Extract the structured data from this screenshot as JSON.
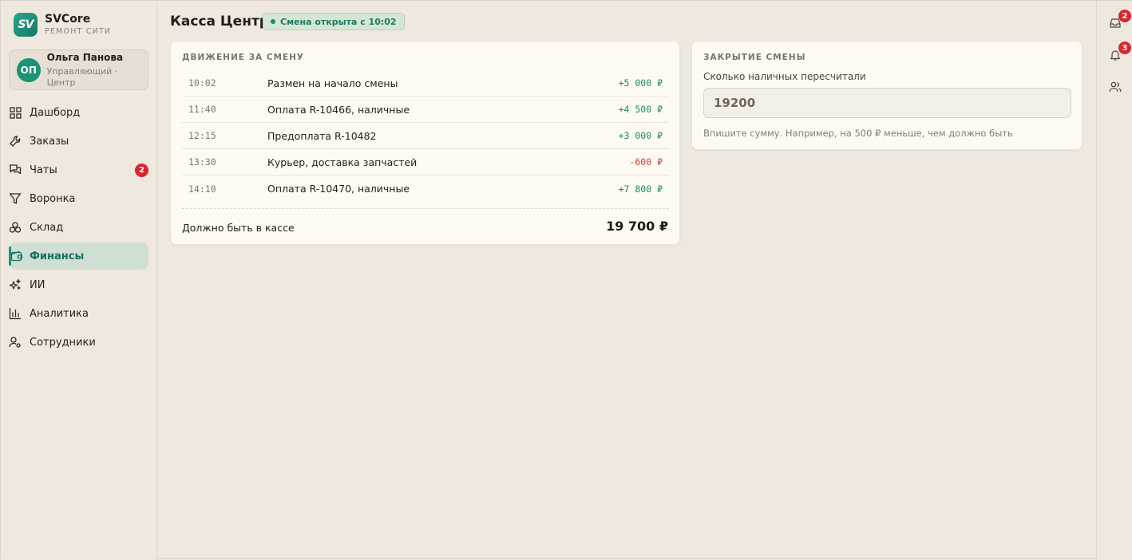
{
  "brand": {
    "logo_text": "SV",
    "name": "SVCore",
    "subtitle": "РЕМОНТ СИТИ"
  },
  "user": {
    "initials": "ОП",
    "name": "Ольга Панова",
    "role": "Управляющий · Центр"
  },
  "nav": {
    "items": [
      {
        "label": "Дашборд",
        "icon": "grid-icon"
      },
      {
        "label": "Заказы",
        "icon": "wrench-icon"
      },
      {
        "label": "Чаты",
        "icon": "chat-icon",
        "badge": "2"
      },
      {
        "label": "Воронка",
        "icon": "funnel-icon"
      },
      {
        "label": "Склад",
        "icon": "boxes-icon"
      },
      {
        "label": "Финансы",
        "icon": "wallet-icon",
        "active": true
      },
      {
        "label": "ИИ",
        "icon": "sparkles-icon"
      },
      {
        "label": "Аналитика",
        "icon": "bar-chart-icon"
      },
      {
        "label": "Сотрудники",
        "icon": "user-settings-icon"
      }
    ]
  },
  "header": {
    "title": "Касса Центр",
    "shift_status": "Смена открыта с 10:02"
  },
  "movement": {
    "title": "ДВИЖЕНИЕ ЗА СМЕНУ",
    "rows": [
      {
        "time": "10:02",
        "desc": "Размен на начало смены",
        "amount": "+5 000 ₽",
        "kind": "plus"
      },
      {
        "time": "11:40",
        "desc": "Оплата R-10466, наличные",
        "amount": "+4 500 ₽",
        "kind": "plus"
      },
      {
        "time": "12:15",
        "desc": "Предоплата R-10482",
        "amount": "+3 000 ₽",
        "kind": "plus"
      },
      {
        "time": "13:30",
        "desc": "Курьер, доставка запчастей",
        "amount": "-600 ₽",
        "kind": "minus"
      },
      {
        "time": "14:10",
        "desc": "Оплата R-10470, наличные",
        "amount": "+7 800 ₽",
        "kind": "plus"
      }
    ],
    "total_label": "Должно быть в кассе",
    "total_value": "19 700 ₽"
  },
  "closing": {
    "title": "ЗАКРЫТИЕ СМЕНЫ",
    "field_label": "Сколько наличных пересчитали",
    "input_value": "19200",
    "hint": "Впишите сумму. Например, на 500 ₽ меньше, чем должно быть"
  },
  "rail": {
    "items": [
      {
        "icon": "inbox-icon",
        "badge": "2"
      },
      {
        "icon": "bell-icon",
        "badge": "3"
      },
      {
        "icon": "users-icon"
      }
    ]
  },
  "colors": {
    "accent": "#1c9277",
    "positive": "#1e8a66",
    "negative": "#d43a36",
    "badge": "#d8262c",
    "background": "#efe8de",
    "card": "#fdfaf4"
  }
}
